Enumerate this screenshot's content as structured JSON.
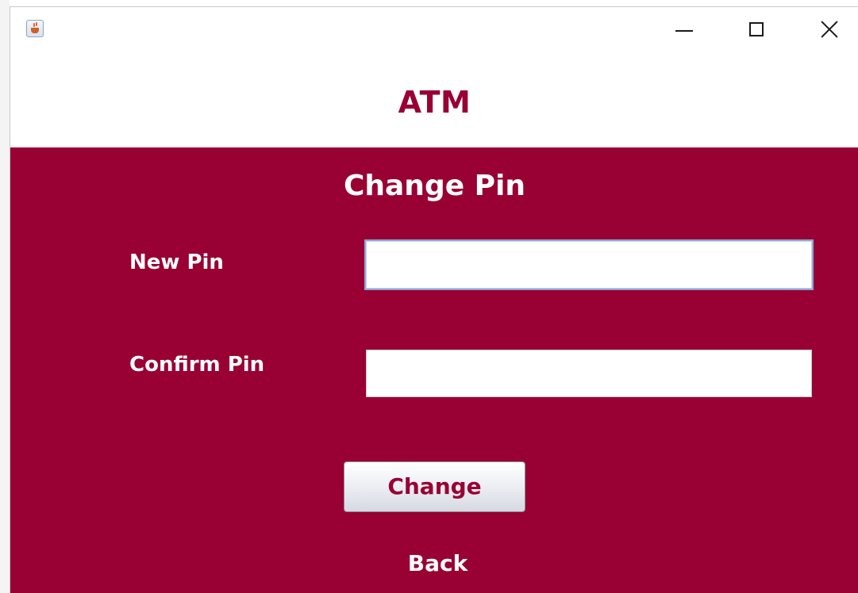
{
  "window": {
    "app_icon": "java-cup-icon",
    "controls": {
      "minimize_icon": "minimize-icon",
      "maximize_icon": "maximize-icon",
      "close_icon": "close-icon"
    }
  },
  "header": {
    "title": "ATM"
  },
  "form": {
    "title": "Change Pin",
    "new_pin_label": "New Pin",
    "new_pin_value": "",
    "confirm_pin_label": "Confirm Pin",
    "confirm_pin_value": "",
    "change_button_label": "Change",
    "back_label": "Back"
  },
  "colors": {
    "brand": "#990033",
    "panel_text": "#ffffff",
    "header_background": "#ffffff"
  }
}
